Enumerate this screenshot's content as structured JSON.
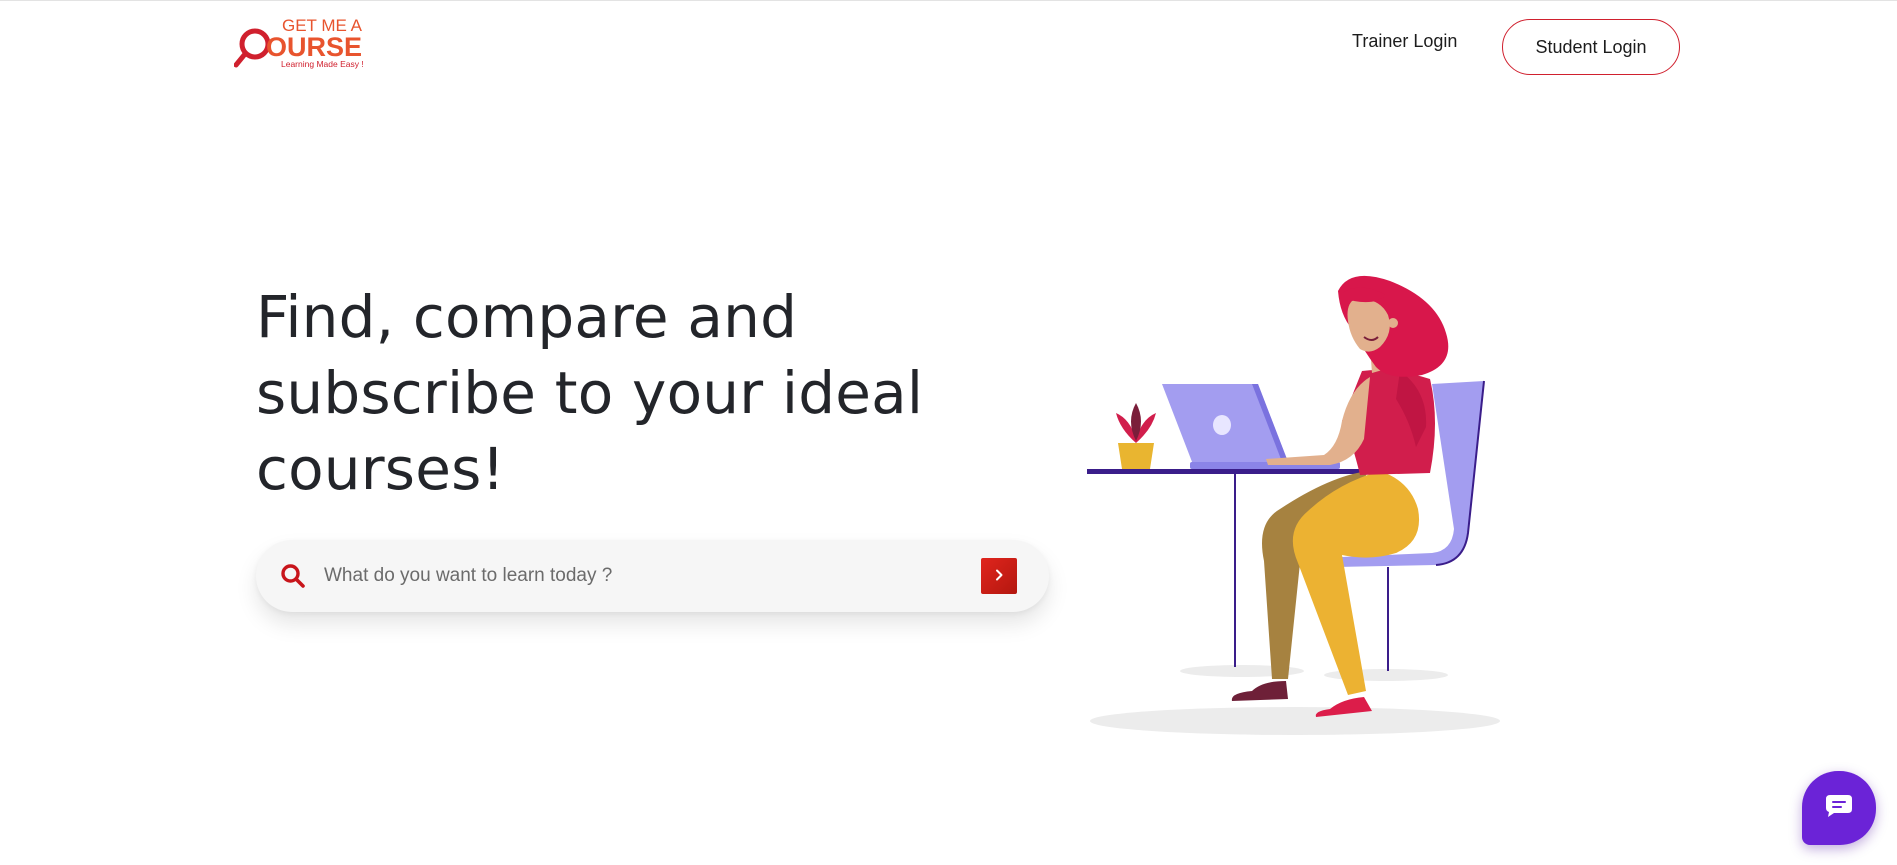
{
  "brand": {
    "logo_line1": "GET ME A",
    "logo_line2": "OURSE",
    "tagline": "Learning Made Easy !",
    "accent_color": "#d0202e",
    "logo_orange": "#e8542e"
  },
  "header": {
    "trainer_login_label": "Trainer Login",
    "student_login_label": "Student Login"
  },
  "hero": {
    "title_line1": "Find, compare and",
    "title_line2": "subscribe to your ideal",
    "title_line3": "courses!"
  },
  "search": {
    "placeholder": "What do you want to learn today ?",
    "value": "",
    "icon": "search-icon",
    "submit_icon": "chevron-right-icon"
  },
  "chat": {
    "icon": "chat-bubble-icon",
    "color": "#6b23d7"
  }
}
